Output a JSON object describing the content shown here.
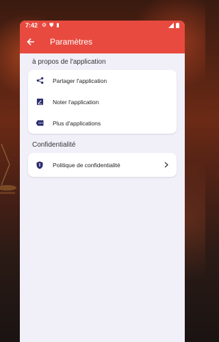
{
  "status_bar": {
    "time": "7:42"
  },
  "app_bar": {
    "title": "Paramètres"
  },
  "sections": [
    {
      "title": "à propos de l'application",
      "items": [
        {
          "label": "Partager l'application",
          "icon": "share-icon"
        },
        {
          "label": "Noter l'application",
          "icon": "rate-icon"
        },
        {
          "label": "Plus d'applications",
          "icon": "more-apps-icon"
        }
      ]
    },
    {
      "title": "Confidentialité",
      "items": [
        {
          "label": "Politique de confidentialité",
          "icon": "shield-icon"
        }
      ]
    }
  ],
  "colors": {
    "accent": "#e94a3f",
    "background": "#f1f0f9",
    "icon": "#2b2d6e"
  }
}
